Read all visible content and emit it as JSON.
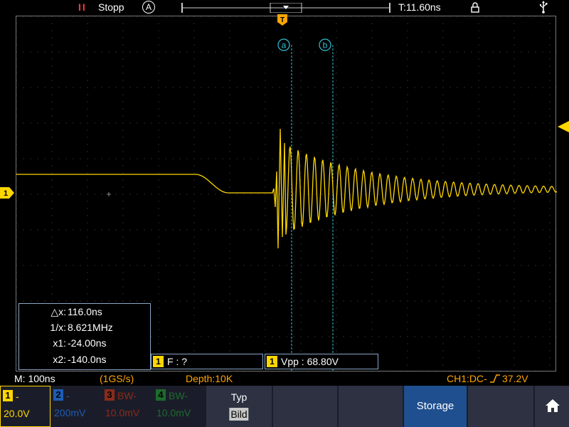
{
  "status": {
    "run_icon": "II",
    "run_state": "Stopp",
    "auto_icon": "A",
    "timebase": "T:11.60ns",
    "lock_icon": "lock-icon",
    "usb_icon": "usb-icon"
  },
  "markers": {
    "trigger_marker": "T",
    "cursor_a": "a",
    "cursor_b": "b",
    "channel1_marker": "1"
  },
  "cursor_info": {
    "dx_label": "△x:",
    "dx_value": "116.0ns",
    "inv_label": "1/x:",
    "inv_value": "8.621MHz",
    "x1_label": "x1:",
    "x1_value": "-24.00ns",
    "x2_label": "x2:",
    "x2_value": "-140.0ns"
  },
  "measurements": {
    "freq_ch": "1",
    "freq_label": "F :    ?",
    "vpp_ch": "1",
    "vpp_label": "Vpp : 68.80V"
  },
  "status_line": {
    "timebase": "M: 100ns",
    "sample_rate": "(1GS/s)",
    "depth": "Depth:10K",
    "trigger": "CH1:DC-",
    "trigger_level": "37.2V"
  },
  "channels": [
    {
      "num": "1",
      "tag": "-",
      "scale": "20.0V",
      "color": "#ffd700"
    },
    {
      "num": "2",
      "tag": "-",
      "scale": "200mV",
      "color": "#1e5cb3"
    },
    {
      "num": "3",
      "tag": "BW-",
      "scale": "10.0mV",
      "color": "#8b2a1a"
    },
    {
      "num": "4",
      "tag": "BW-",
      "scale": "10.0mV",
      "color": "#1e6a2e"
    }
  ],
  "softkeys": {
    "typ_label": "Typ",
    "typ_value": "Bild",
    "storage_label": "Storage",
    "home_icon": "home-icon"
  },
  "colors": {
    "trace": "#ffd700",
    "cursor": "#31c3d6",
    "accent_red": "#ff3b30",
    "bottom_bg": "#1a1d29"
  }
}
